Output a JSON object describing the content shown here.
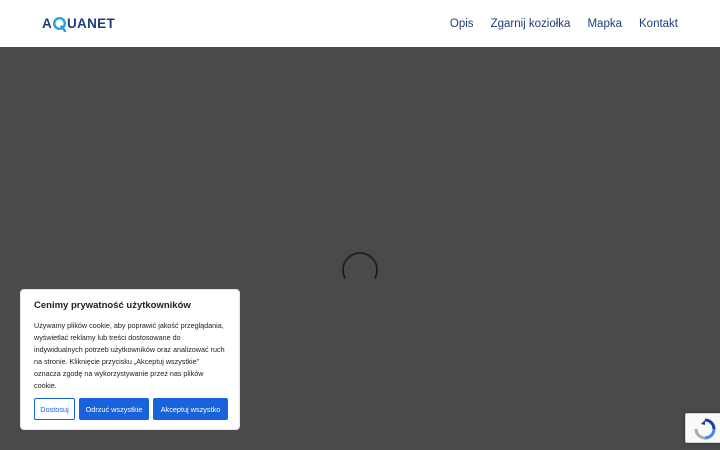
{
  "header": {
    "logo_text": "AQUANET",
    "nav": [
      {
        "label": "Opis"
      },
      {
        "label": "Zgarnij koziołka"
      },
      {
        "label": "Mapka"
      },
      {
        "label": "Kontakt"
      }
    ]
  },
  "cookie_banner": {
    "title": "Cenimy prywatność użytkowników",
    "text": "Używamy plików cookie, aby poprawić jakość przeglądania, wyświetlać reklamy lub treści dostosowane do indywidualnych potrzeb użytkowników oraz analizować ruch na stronie. Kliknięcie przycisku „Akceptuj wszystkie” oznacza zgodę na wykorzystywanie przez nas plików cookie.",
    "customize_label": "Dostosuj",
    "reject_label": "Odrzuć wszystkie",
    "accept_label": "Akceptuj wszystko"
  },
  "colors": {
    "brand_navy": "#1f3d7a",
    "brand_cyan": "#1fa3d8",
    "button_blue": "#1863dc",
    "overlay": "#4a4a4a"
  },
  "icons": {
    "spinner": "loading-spinner-icon",
    "recaptcha": "recaptcha-icon"
  }
}
